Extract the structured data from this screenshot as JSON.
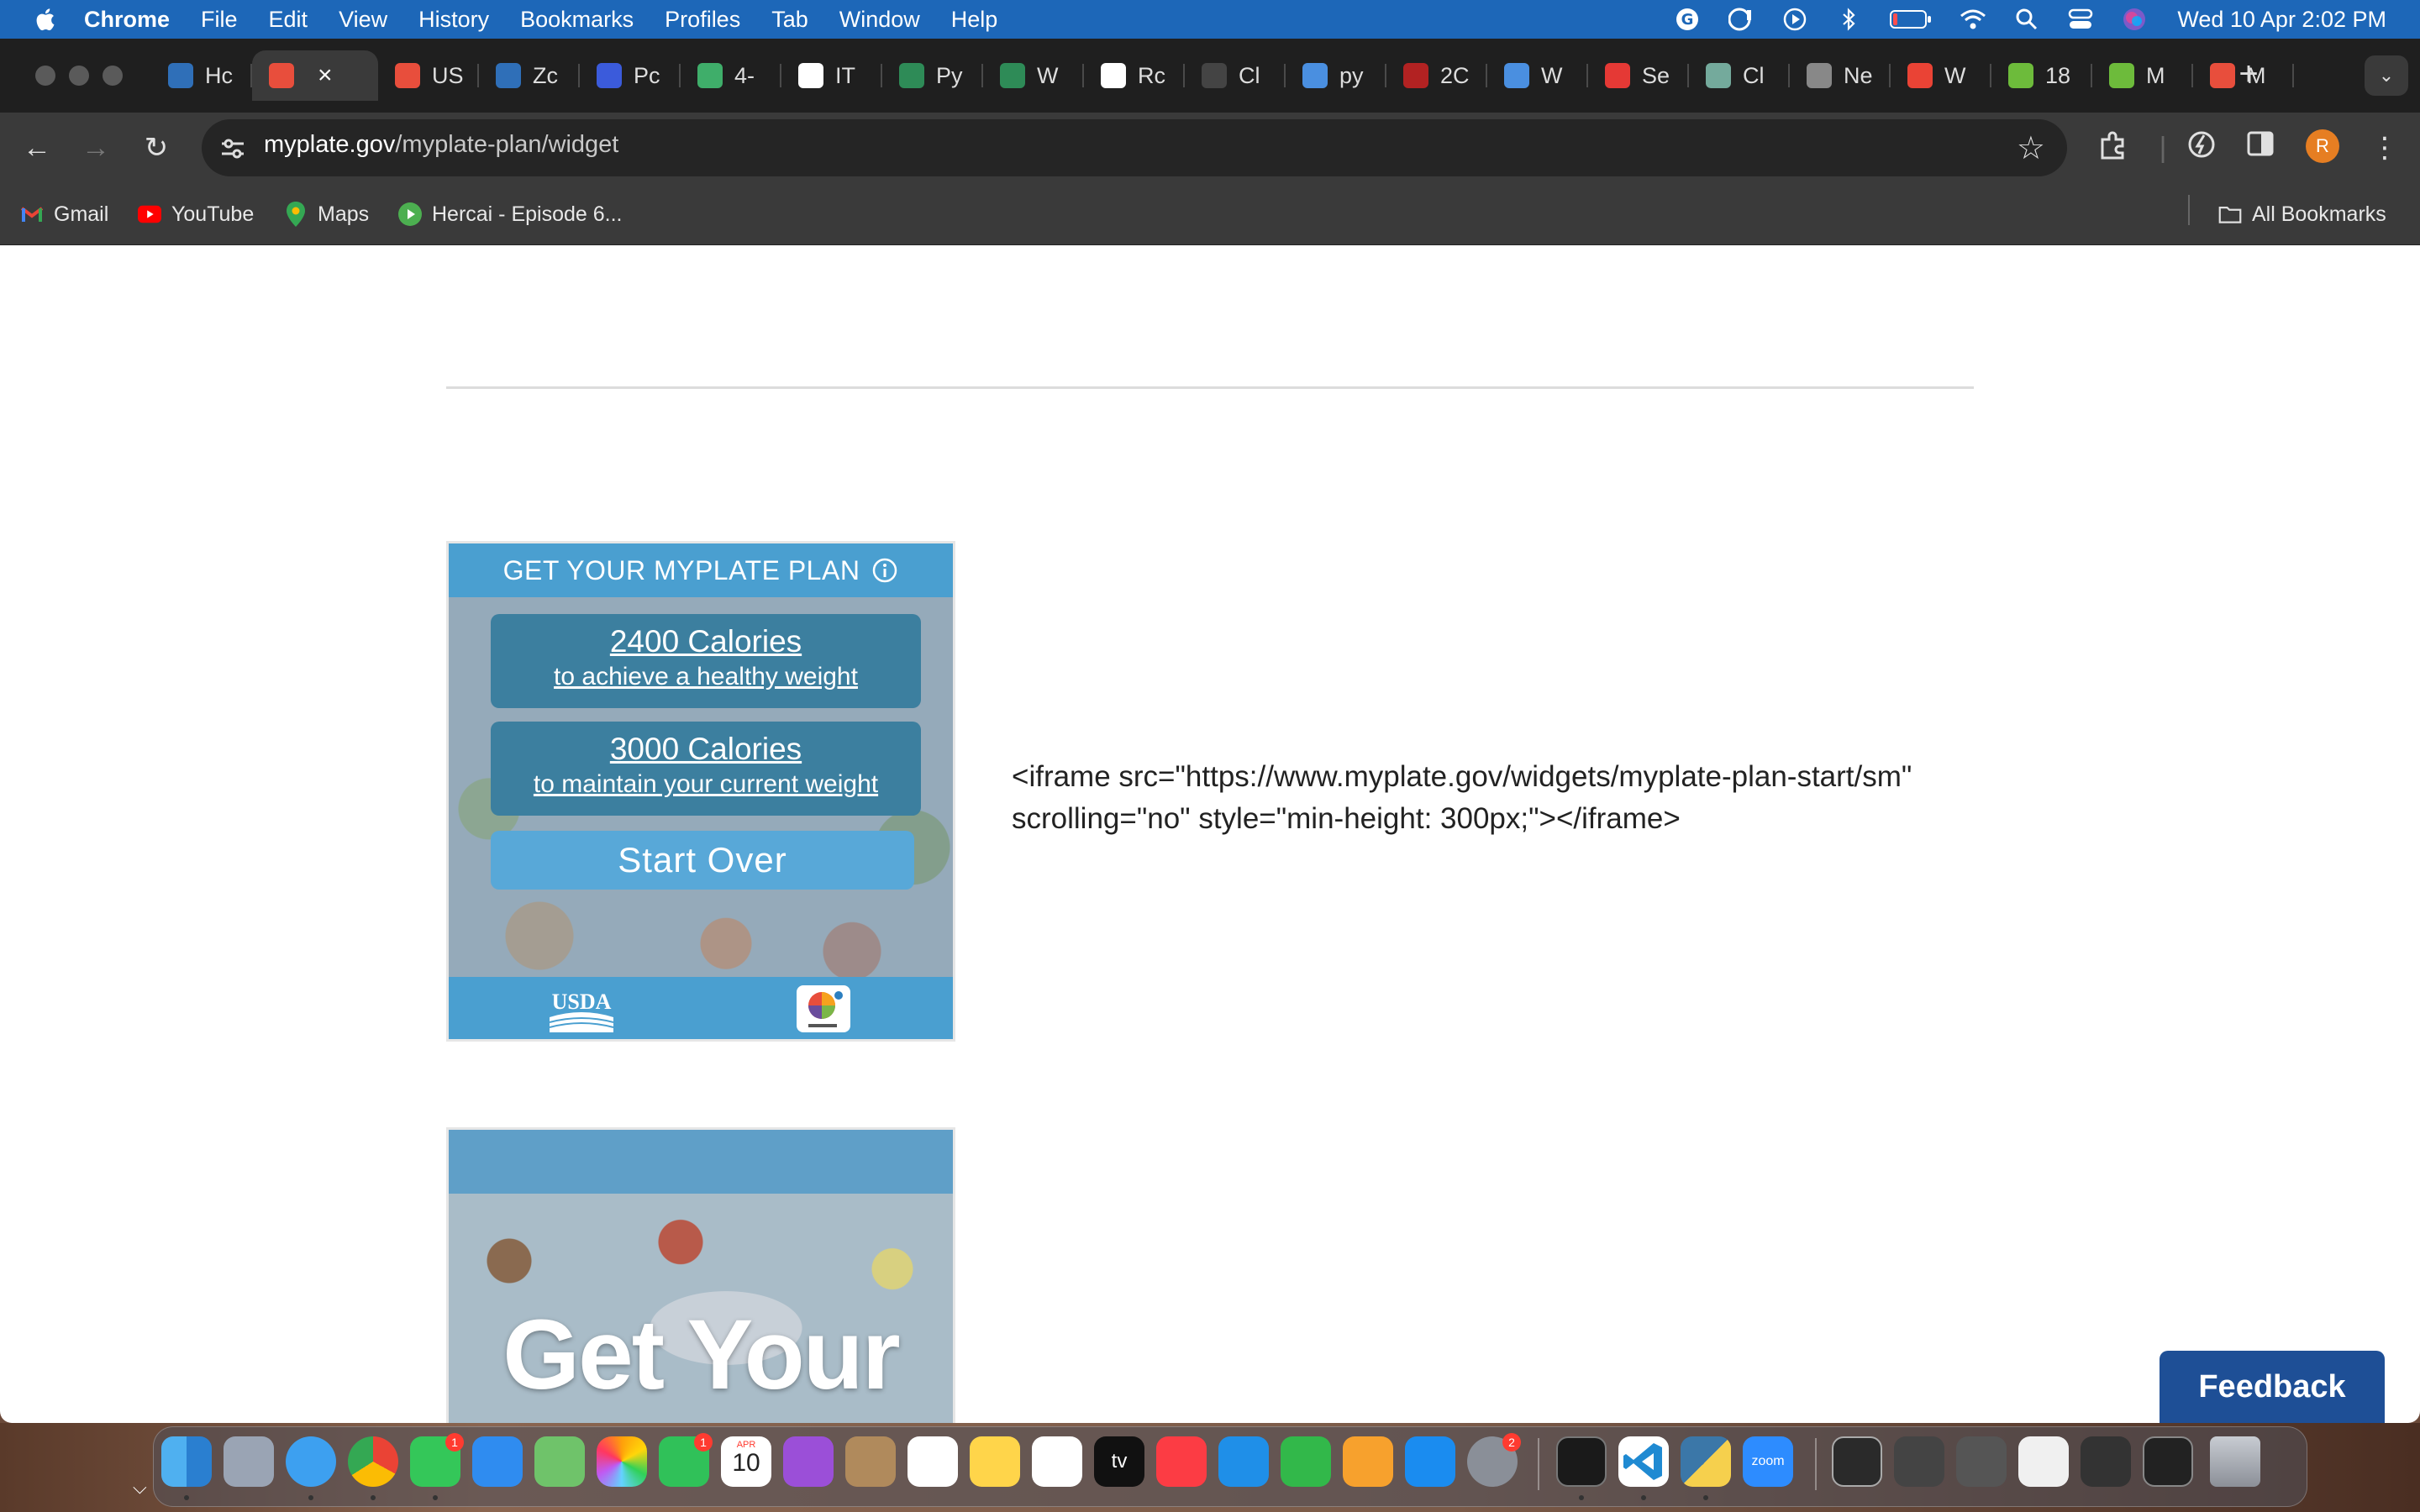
{
  "menubar": {
    "app": "Chrome",
    "items": [
      "File",
      "Edit",
      "View",
      "History",
      "Bookmarks",
      "Profiles",
      "Tab",
      "Window",
      "Help"
    ],
    "clock": "Wed 10 Apr  2:02 PM"
  },
  "tabs": [
    {
      "label": "Hc",
      "icon": "chart-favicon",
      "color": "#2f6fb8"
    },
    {
      "label": "",
      "icon": "myplate-favicon",
      "color": "#e84e3c",
      "active": true
    },
    {
      "label": "US",
      "icon": "myplate-favicon",
      "color": "#e84e3c"
    },
    {
      "label": "Zc",
      "icon": "chart-favicon",
      "color": "#2f6fb8"
    },
    {
      "label": "Pc",
      "icon": "zm-favicon",
      "color": "#3b5bdb"
    },
    {
      "label": "4-",
      "icon": "cube-favicon",
      "color": "#3fae6a"
    },
    {
      "label": "IT",
      "icon": "github-icon",
      "color": "#ffffff"
    },
    {
      "label": "Py",
      "icon": "w-favicon",
      "color": "#2e8b57"
    },
    {
      "label": "W",
      "icon": "w-favicon",
      "color": "#2e8b57"
    },
    {
      "label": "Rc",
      "icon": "github-icon",
      "color": "#ffffff"
    },
    {
      "label": "Cl",
      "icon": "dots-favicon",
      "color": "#444444"
    },
    {
      "label": "py",
      "icon": "search-favicon",
      "color": "#4a8fe0"
    },
    {
      "label": "2C",
      "icon": "p-favicon",
      "color": "#b22222"
    },
    {
      "label": "W",
      "icon": "search-favicon",
      "color": "#4a8fe0"
    },
    {
      "label": "Se",
      "icon": "oracle-favicon",
      "color": "#e53935"
    },
    {
      "label": "Cl",
      "icon": "chatgpt-favicon",
      "color": "#74aa9c"
    },
    {
      "label": "Ne",
      "icon": "globe-favicon",
      "color": "#888888"
    },
    {
      "label": "W",
      "icon": "gmail-favicon",
      "color": "#ea4335"
    },
    {
      "label": "18",
      "icon": "recycle-favicon",
      "color": "#6dbb3b"
    },
    {
      "label": "M",
      "icon": "recycle-favicon",
      "color": "#6dbb3b"
    },
    {
      "label": "M",
      "icon": "myplate-favicon",
      "color": "#e84e3c"
    }
  ],
  "address": {
    "host": "myplate.gov",
    "path": "/myplate-plan/widget"
  },
  "profile_initial": "R",
  "bookmarks": [
    {
      "label": "Gmail",
      "icon": "gmail-icon"
    },
    {
      "label": "YouTube",
      "icon": "youtube-icon"
    },
    {
      "label": "Maps",
      "icon": "maps-icon"
    },
    {
      "label": "Hercai - Episode 6...",
      "icon": "play-icon"
    }
  ],
  "all_bookmarks": "All Bookmarks",
  "widget1": {
    "title": "GET YOUR MYPLATE PLAN",
    "option1_cal": "2400 Calories",
    "option1_desc": "to achieve a healthy weight",
    "option2_cal": "3000 Calories",
    "option2_desc": "to maintain your current weight",
    "start_over": "Start Over"
  },
  "embed_code": "<iframe src=\"https://www.myplate.gov/widgets/myplate-plan-start/sm\" scrolling=\"no\" style=\"min-height: 300px;\"></iframe>",
  "widget2": {
    "title": "Get Your"
  },
  "feedback": "Feedback",
  "dock": {
    "messages_badge": "1",
    "facetime_badge": "1",
    "settings_badge": "2",
    "calendar_month": "APR",
    "calendar_day": "10",
    "zoom_label": "zoom",
    "tv_label": "tv"
  }
}
